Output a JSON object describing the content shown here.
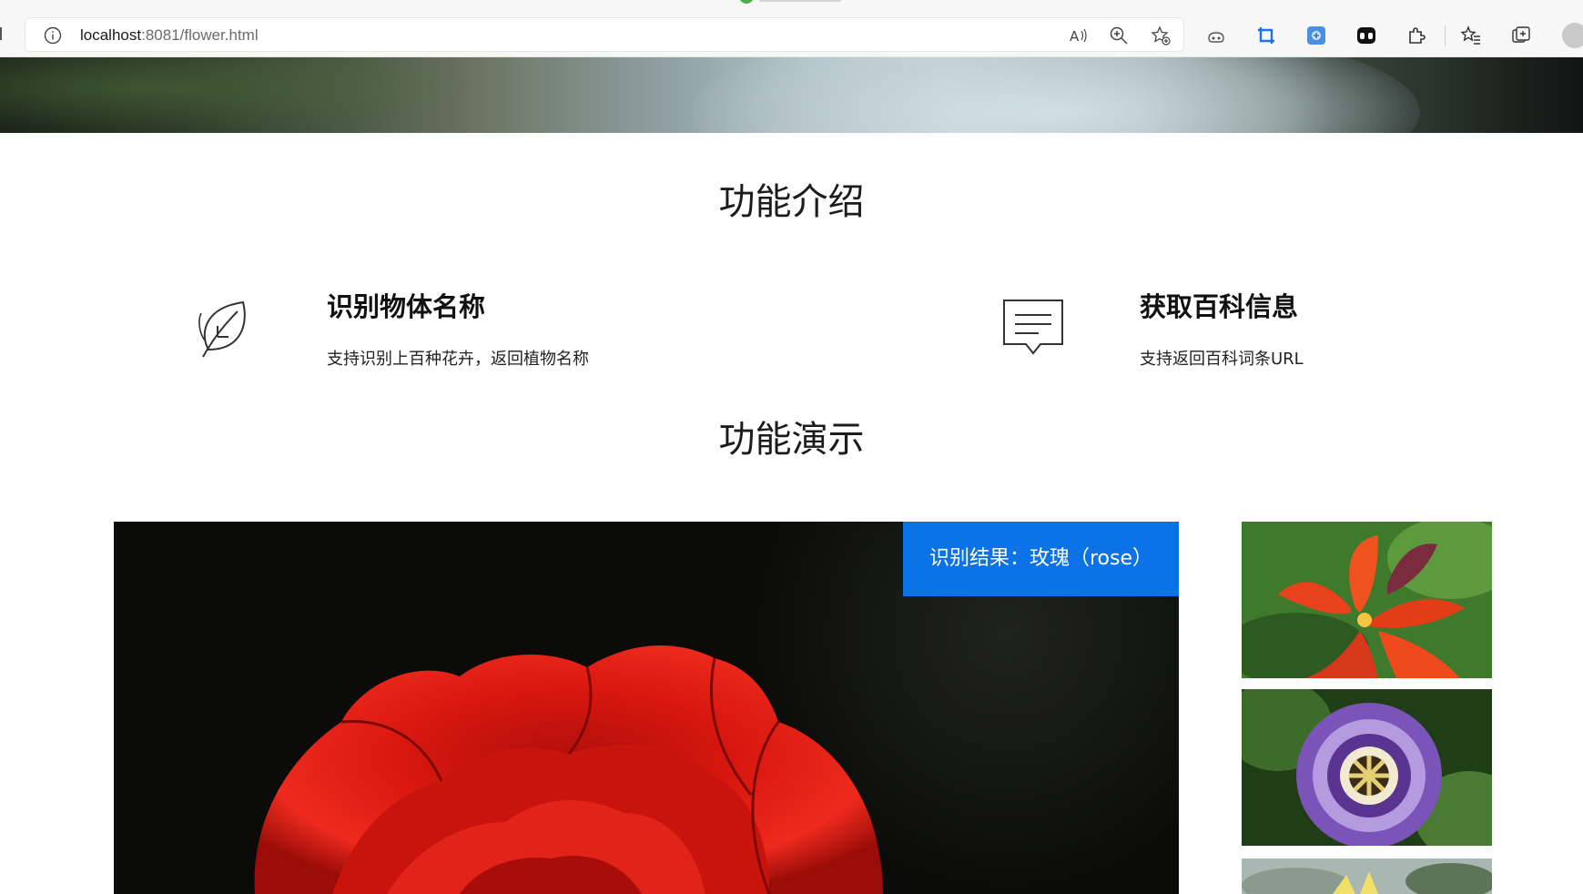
{
  "browser": {
    "url_host": "localhost",
    "url_rest": ":8081/flower.html",
    "toolbar_icons": [
      "info-icon",
      "read-aloud-icon",
      "zoom-icon",
      "add-favorite-icon",
      "copilot-icon",
      "crop-icon",
      "extension-blue-icon",
      "extension-dark-icon",
      "extensions-puzzle-icon",
      "favorites-icon",
      "collections-icon",
      "profile-avatar"
    ]
  },
  "sections": {
    "intro_title": "功能介绍",
    "demo_title": "功能演示"
  },
  "features": [
    {
      "icon": "leaf-icon",
      "title": "识别物体名称",
      "desc": "支持识别上百种花卉，返回植物名称"
    },
    {
      "icon": "chat-bubble-icon",
      "title": "获取百科信息",
      "desc": "支持返回百科词条URL"
    }
  ],
  "demo": {
    "result_label": "识别结果：玫瑰（rose）",
    "accent_color": "#0b72e7",
    "thumbnails": [
      "orange-flower",
      "passion-flower",
      "water-lily"
    ]
  }
}
